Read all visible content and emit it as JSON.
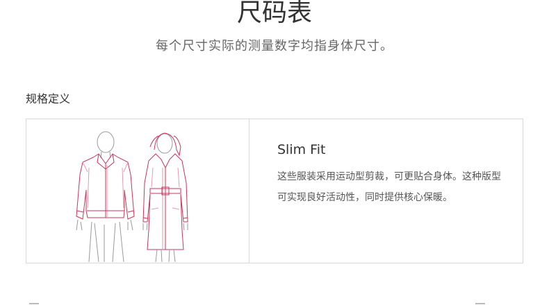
{
  "header": {
    "title": "尺码表",
    "subtitle": "每个尺寸实际的测量数字均指身体尺寸。"
  },
  "section": {
    "heading": "规格定义"
  },
  "fit": {
    "name": "Slim Fit",
    "description": "这些服装采用运动型剪裁，可更贴合身体。这种版型可实现良好活动性，同时提供核心保暖。",
    "illustration": "slim-fit-jacket-and-coat-illustration"
  },
  "colors": {
    "accent": "#c8355a",
    "figure_line": "#999999",
    "border": "#d8d8d8",
    "title_text": "#333333",
    "body_text": "#555555"
  }
}
